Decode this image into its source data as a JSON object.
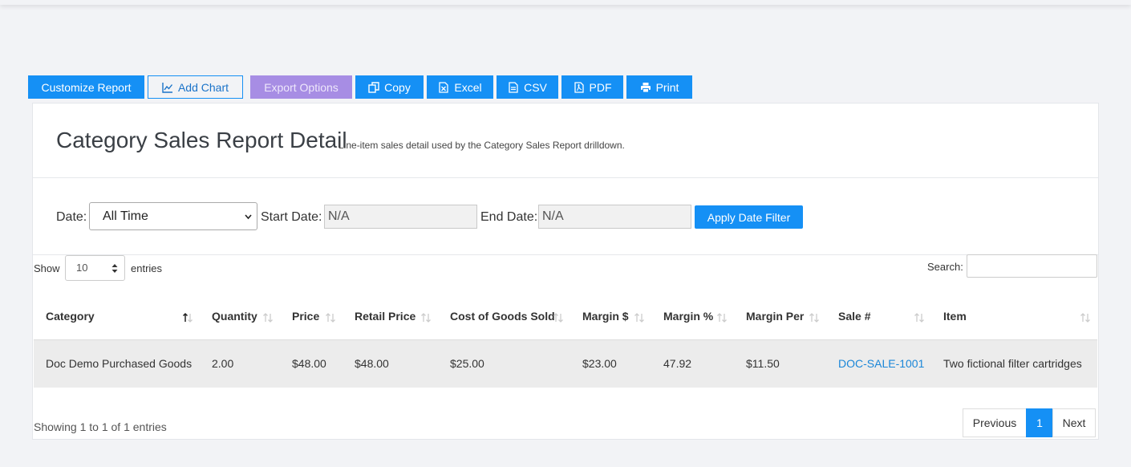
{
  "toolbar": {
    "customize_report": "Customize Report",
    "add_chart": "Add Chart",
    "export_options": "Export Options",
    "copy": "Copy",
    "excel": "Excel",
    "csv": "CSV",
    "pdf": "PDF",
    "print": "Print"
  },
  "report": {
    "title": "Category Sales Report Detail",
    "subtitle": "Line-item sales detail used by the Category Sales Report drilldown."
  },
  "filters": {
    "date_label": "Date:",
    "date_value": "All Time",
    "start_label": "Start Date:",
    "start_value": "N/A",
    "end_label": "End Date:",
    "end_value": "N/A",
    "apply_label": "Apply Date Filter"
  },
  "table_controls": {
    "show_label": "Show",
    "length_value": "10",
    "entries_label": "entries",
    "search_label": "Search:"
  },
  "table": {
    "columns": [
      "Category",
      "Quantity",
      "Price",
      "Retail Price",
      "Cost of Goods Sold",
      "Margin $",
      "Margin %",
      "Margin Per",
      "Sale #",
      "Item"
    ],
    "rows": [
      [
        "Doc Demo Purchased Goods",
        "2.00",
        "$48.00",
        "$48.00",
        "$25.00",
        "$23.00",
        "47.92",
        "$11.50",
        "DOC-SALE-1001",
        "Two fictional filter cartridges"
      ]
    ]
  },
  "footer": {
    "info": "Showing 1 to 1 of 1 entries",
    "previous": "Previous",
    "current_page": "1",
    "next": "Next"
  },
  "icons": {
    "add_chart": "line-chart-icon",
    "copy": "copy-icon",
    "excel": "excel-file-icon",
    "csv": "file-icon",
    "pdf": "pdf-file-icon",
    "print": "print-icon"
  },
  "colors": {
    "primary": "#1590f5",
    "disabled": "#a78de4",
    "link": "#1a86d8"
  }
}
